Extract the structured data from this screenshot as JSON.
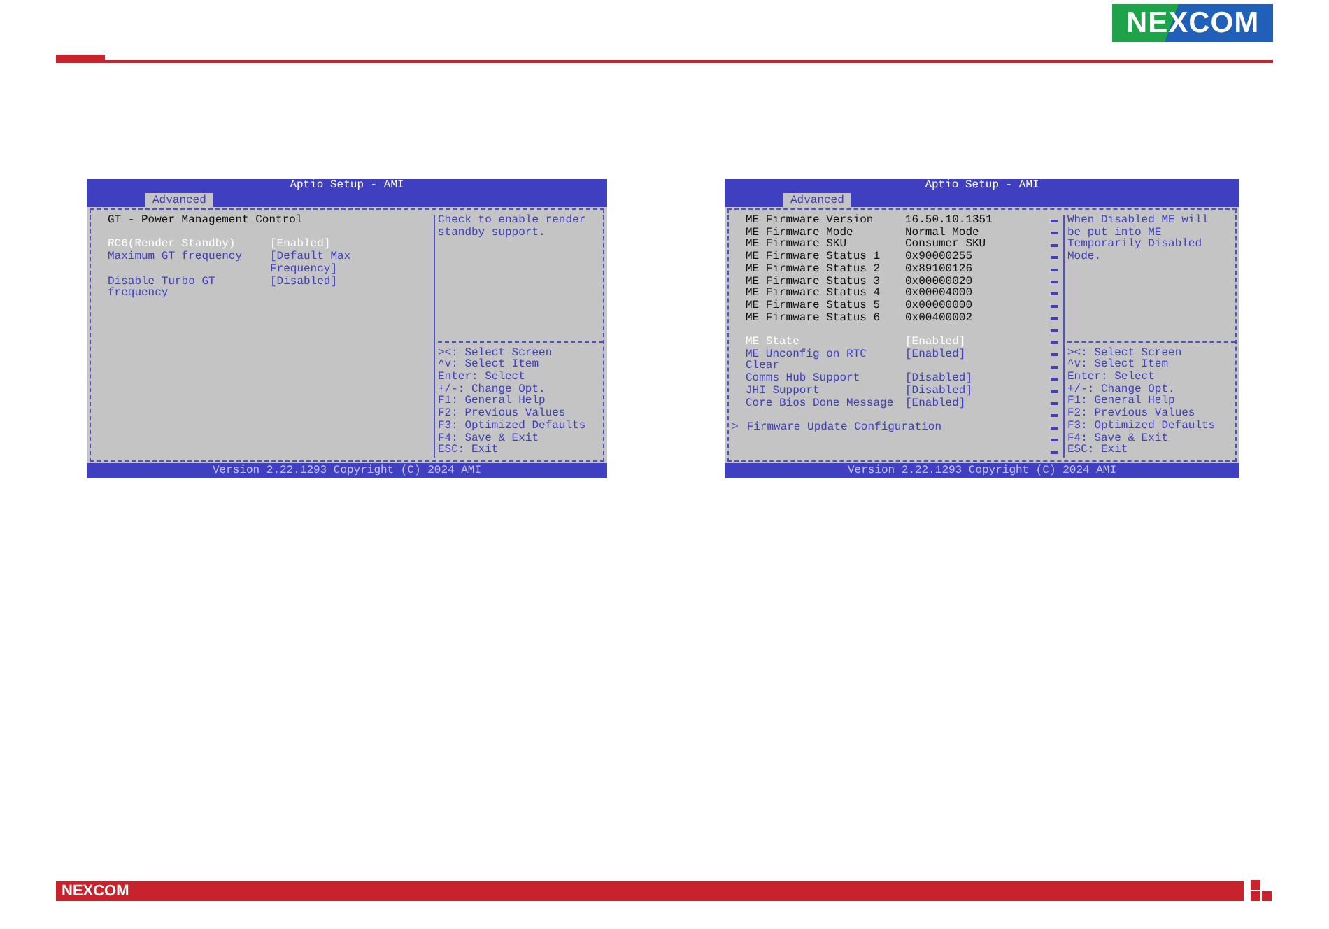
{
  "header": {
    "logo": "NEXCOM"
  },
  "screens": [
    {
      "title": "Aptio Setup - AMI",
      "tab": "Advanced",
      "heading": "GT - Power Management Control",
      "scrollbar": false,
      "settings": [
        {
          "kind": "option",
          "label": "RC6(Render Standby)",
          "value": "[Enabled]",
          "selected": true
        },
        {
          "kind": "option",
          "label": "Maximum GT frequency",
          "value": "[Default Max Frequency]",
          "selected": false
        },
        {
          "kind": "option",
          "label": "Disable Turbo GT frequency",
          "value": "[Disabled]",
          "selected": false
        }
      ],
      "help": "Check to enable render standby support.",
      "keys": [
        "><: Select Screen",
        "^v: Select Item",
        "Enter: Select",
        "+/-: Change Opt.",
        "F1: General Help",
        "F2: Previous Values",
        "F3: Optimized Defaults",
        "F4: Save & Exit",
        "ESC: Exit"
      ],
      "footer": "Version 2.22.1293 Copyright (C) 2024 AMI"
    },
    {
      "title": "Aptio Setup - AMI",
      "tab": "Advanced",
      "scrollbar": true,
      "info_rows": [
        {
          "label": "ME Firmware Version",
          "value": "16.50.10.1351"
        },
        {
          "label": "ME Firmware Mode",
          "value": "Normal Mode"
        },
        {
          "label": "ME Firmware SKU",
          "value": "Consumer SKU"
        },
        {
          "label": "ME Firmware Status 1",
          "value": "0x90000255"
        },
        {
          "label": "ME Firmware Status 2",
          "value": "0x89100126"
        },
        {
          "label": "ME Firmware Status 3",
          "value": "0x00000020"
        },
        {
          "label": "ME Firmware Status 4",
          "value": "0x00004000"
        },
        {
          "label": "ME Firmware Status 5",
          "value": "0x00000000"
        },
        {
          "label": "ME Firmware Status 6",
          "value": "0x00400002"
        }
      ],
      "settings": [
        {
          "kind": "option",
          "label": "ME State",
          "value": "[Enabled]",
          "selected": true
        },
        {
          "kind": "option",
          "label": "ME Unconfig on RTC Clear",
          "value": "[Enabled]",
          "selected": false
        },
        {
          "kind": "option",
          "label": "Comms Hub Support",
          "value": "[Disabled]",
          "selected": false
        },
        {
          "kind": "option",
          "label": "JHI Support",
          "value": "[Disabled]",
          "selected": false
        },
        {
          "kind": "option",
          "label": "Core Bios Done Message",
          "value": "[Enabled]",
          "selected": false
        },
        {
          "kind": "submenu",
          "marker": ">",
          "label": "Firmware Update Configuration",
          "selected": false
        }
      ],
      "help": "When Disabled ME will be put into ME Temporarily Disabled Mode.",
      "keys": [
        "><: Select Screen",
        "^v: Select Item",
        "Enter: Select",
        "+/-: Change Opt.",
        "F1: General Help",
        "F2: Previous Values",
        "F3: Optimized Defaults",
        "F4: Save & Exit",
        "ESC: Exit"
      ],
      "footer": "Version 2.22.1293 Copyright (C) 2024 AMI"
    }
  ],
  "footer": {
    "logo": "NEXCOM"
  }
}
